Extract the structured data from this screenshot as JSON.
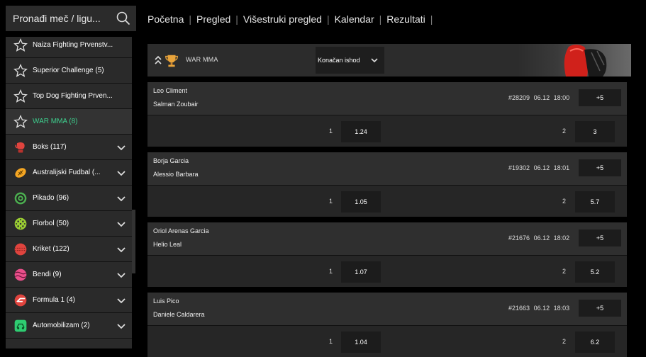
{
  "search": {
    "placeholder": "Pronađi meč / ligu..."
  },
  "topnav": [
    "Početna",
    "Pregled",
    "Višestruki pregled",
    "Kalendar",
    "Rezultati"
  ],
  "sidebar": {
    "items": [
      {
        "label": "Naiza Fighting Prvenstv...",
        "icon": "star-icon"
      },
      {
        "label": "Superior Challenge (5)",
        "icon": "star-icon"
      },
      {
        "label": "Top Dog Fighting Prven...",
        "icon": "star-icon"
      },
      {
        "label": "WAR MMA (8)",
        "icon": "star-icon"
      },
      {
        "label": "Boks (117)",
        "icon": "boxing-glove-icon",
        "color": "#e0443e"
      },
      {
        "label": "Australijski Fudbal (...",
        "icon": "aussie-football-icon",
        "color": "#f5a623"
      },
      {
        "label": "Pikado (96)",
        "icon": "darts-icon",
        "color": "#4caf50"
      },
      {
        "label": "Florbol (50)",
        "icon": "floorball-icon",
        "color": "#9acd32"
      },
      {
        "label": "Kriket (122)",
        "icon": "cricket-icon",
        "color": "#e0443e"
      },
      {
        "label": "Bendi (9)",
        "icon": "bandy-icon",
        "color": "#e94f8a"
      },
      {
        "label": "Formula 1 (4)",
        "icon": "formula1-icon",
        "color": "#e0443e"
      },
      {
        "label": "Automobilizam (2)",
        "icon": "motorsport-icon",
        "color": "#2ecc71"
      }
    ]
  },
  "league": {
    "name": "WAR MMA",
    "market": "Konačan ishod"
  },
  "matches": [
    {
      "home": "Leo Climent",
      "away": "Salman Zoubair",
      "id": "#28209",
      "date": "06.12",
      "time": "18:00",
      "more": "+5",
      "label1": "1",
      "odd1": "1.24",
      "label2": "2",
      "odd2": "3"
    },
    {
      "home": "Borja Garcia",
      "away": "Alessio Barbara",
      "id": "#19302",
      "date": "06.12",
      "time": "18:01",
      "more": "+5",
      "label1": "1",
      "odd1": "1.05",
      "label2": "2",
      "odd2": "5.7"
    },
    {
      "home": "Oriol Arenas Garcia",
      "away": "Helio Leal",
      "id": "#21676",
      "date": "06.12",
      "time": "18:02",
      "more": "+5",
      "label1": "1",
      "odd1": "1.07",
      "label2": "2",
      "odd2": "5.2"
    },
    {
      "home": "Luis Pico",
      "away": "Daniele Caldarera",
      "id": "#21663",
      "date": "06.12",
      "time": "18:03",
      "more": "+5",
      "label1": "1",
      "odd1": "1.04",
      "label2": "2",
      "odd2": "6.2"
    }
  ]
}
